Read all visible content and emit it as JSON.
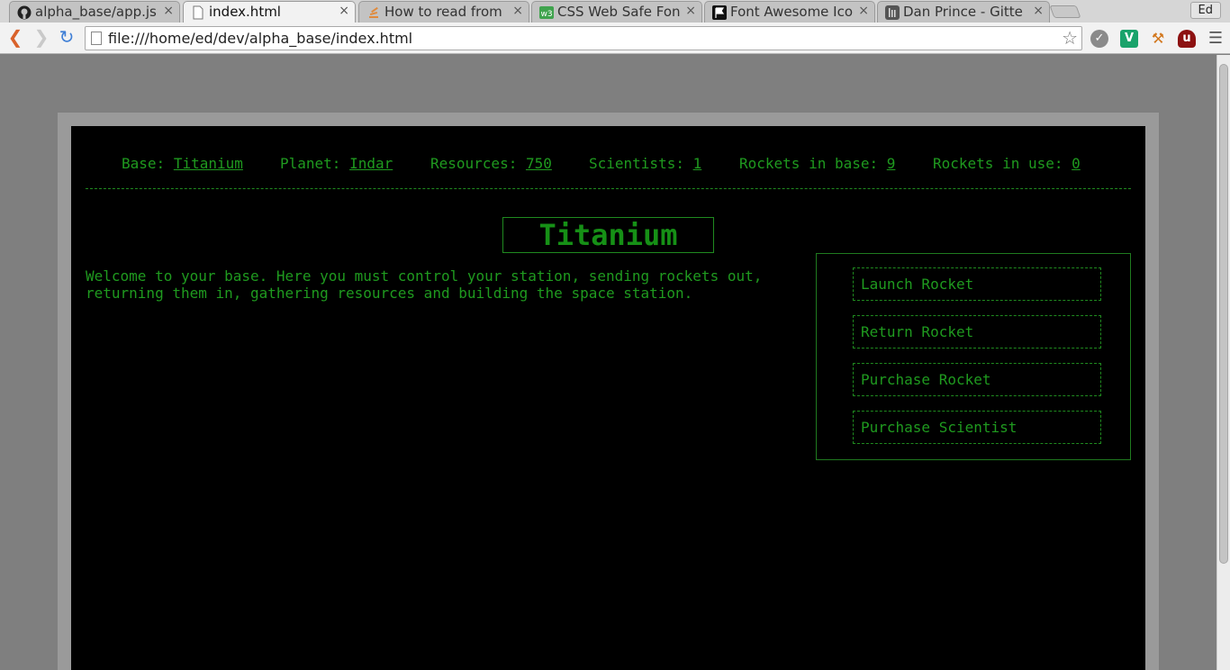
{
  "browser": {
    "tabs": [
      {
        "title": "alpha_base/app.js",
        "favicon": "github-icon",
        "active": false
      },
      {
        "title": "index.html",
        "favicon": "file-icon",
        "active": true
      },
      {
        "title": "How to read from",
        "favicon": "stackoverflow-icon",
        "active": false
      },
      {
        "title": "CSS Web Safe Fon",
        "favicon": "w3schools-icon",
        "active": false
      },
      {
        "title": "Font Awesome Ico",
        "favicon": "flag-icon",
        "active": false
      },
      {
        "title": "Dan Prince - Gitte",
        "favicon": "gitter-icon",
        "active": false
      }
    ],
    "profile": "Ed",
    "url": "file:///home/ed/dev/alpha_base/index.html"
  },
  "game": {
    "stats": {
      "base_label": "Base:",
      "base_value": "Titanium",
      "planet_label": "Planet:",
      "planet_value": "Indar",
      "resources_label": "Resources:",
      "resources_value": "750",
      "scientists_label": "Scientists:",
      "scientists_value": "1",
      "rockets_base_label": "Rockets in base:",
      "rockets_base_value": "9",
      "rockets_use_label": "Rockets in use:",
      "rockets_use_value": "0"
    },
    "title": "Titanium",
    "welcome": "Welcome to your base. Here you must control your station, sending rockets out, returning them in, gathering resources and building the space station.",
    "actions": {
      "launch": "Launch Rocket",
      "return": "Return Rocket",
      "purchase_rocket": "Purchase Rocket",
      "purchase_scientist": "Purchase Scientist"
    },
    "colors": {
      "text": "#1f9a1f",
      "background": "#000000"
    }
  }
}
